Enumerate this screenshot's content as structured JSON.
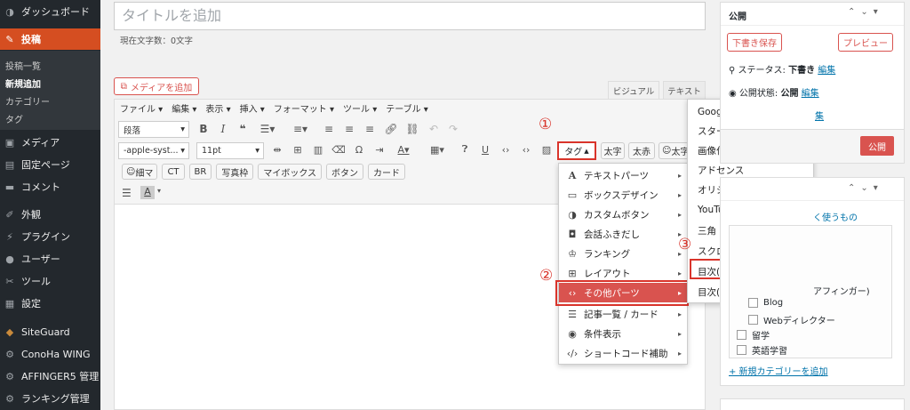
{
  "sidebar": {
    "dashboard": "ダッシュボード",
    "posts": "投稿",
    "submenu": [
      "投稿一覧",
      "新規追加",
      "カテゴリー",
      "タグ"
    ],
    "items": [
      {
        "label": "メディア",
        "icon": "media-icon"
      },
      {
        "label": "固定ページ",
        "icon": "pages-icon"
      },
      {
        "label": "コメント",
        "icon": "comment-icon"
      },
      {
        "label": "外観",
        "icon": "appearance-icon"
      },
      {
        "label": "プラグイン",
        "icon": "plugin-icon"
      },
      {
        "label": "ユーザー",
        "icon": "user-icon"
      },
      {
        "label": "ツール",
        "icon": "tools-icon"
      },
      {
        "label": "設定",
        "icon": "settings-icon"
      },
      {
        "label": "SiteGuard",
        "icon": "siteguard-icon"
      },
      {
        "label": "ConoHa WING",
        "icon": "conoha-icon"
      },
      {
        "label": "AFFINGER5 管理",
        "icon": "gear-icon"
      },
      {
        "label": "ランキング管理",
        "icon": "gear-icon"
      }
    ]
  },
  "editor": {
    "title_placeholder": "タイトルを追加",
    "char_count": "現在文字数：0文字",
    "add_media": "メディアを追加",
    "tab_visual": "ビジュアル",
    "tab_text": "テキスト",
    "menubar": [
      "ファイル",
      "編集",
      "表示",
      "挿入",
      "フォーマット",
      "ツール",
      "テーブル"
    ],
    "format_select": "段落",
    "font_select": "-apple-syst...",
    "size_select": "11pt",
    "tag_button": "タグ",
    "bold_button": "太字",
    "red_bold_button": "太赤",
    "more_button": "太字",
    "row3_buttons": [
      "細マ",
      "CT",
      "BR",
      "写真枠",
      "マイボックス",
      "ボタン",
      "カード"
    ]
  },
  "dropdown1": [
    {
      "label": "テキストパーツ",
      "icon": "text-icon"
    },
    {
      "label": "ボックスデザイン",
      "icon": "box-icon"
    },
    {
      "label": "カスタムボタン",
      "icon": "toggle-icon"
    },
    {
      "label": "会話ふきだし",
      "icon": "chat-icon"
    },
    {
      "label": "ランキング",
      "icon": "crown-icon"
    },
    {
      "label": "レイアウト",
      "icon": "grid-icon"
    },
    {
      "label": "その他パーツ",
      "icon": "code-icon"
    },
    {
      "label": "記事一覧 / カード",
      "icon": "list-icon"
    },
    {
      "label": "条件表示",
      "icon": "eye-icon"
    },
    {
      "label": "ショートコード補助",
      "icon": "code-icon"
    }
  ],
  "dropdown2": [
    {
      "label": "Googleアイコン",
      "arrow": true
    },
    {
      "label": "スター",
      "arrow": true
    },
    {
      "label": "画像付きコメント",
      "arrow": false
    },
    {
      "label": "アドセンス",
      "arrow": false
    },
    {
      "label": "オリジナルショートコード",
      "arrow": false
    },
    {
      "label": "YouTube",
      "arrow": false
    },
    {
      "label": "三角（下矢印）",
      "arrow": false
    },
    {
      "label": "スクロールナビ",
      "arrow": false
    },
    {
      "label": "目次(カスタム)",
      "arrow": false
    },
    {
      "label": "目次(TOC+)",
      "arrow": false
    }
  ],
  "annotations": {
    "one": "①",
    "two": "②",
    "three": "③"
  },
  "publish": {
    "title": "公開",
    "save_draft": "下書き保存",
    "preview": "プレビュー",
    "status_label": "ステータス: ",
    "status_value": "下書き",
    "edit": "編集",
    "visibility_label": "公開状態: ",
    "visibility_value": "公開",
    "partial": "集",
    "publish_button": "公開"
  },
  "categories": {
    "used_link": "く使うもの",
    "partial_item": "アフィンガー)",
    "items": [
      "Blog",
      "Webディレクター",
      "留学",
      "英語学習"
    ],
    "add_new": "+ 新規カテゴリーを追加"
  },
  "colors": {
    "accent": "#d54e21",
    "annotation": "#d9342b",
    "sidebar": "#23282d"
  }
}
